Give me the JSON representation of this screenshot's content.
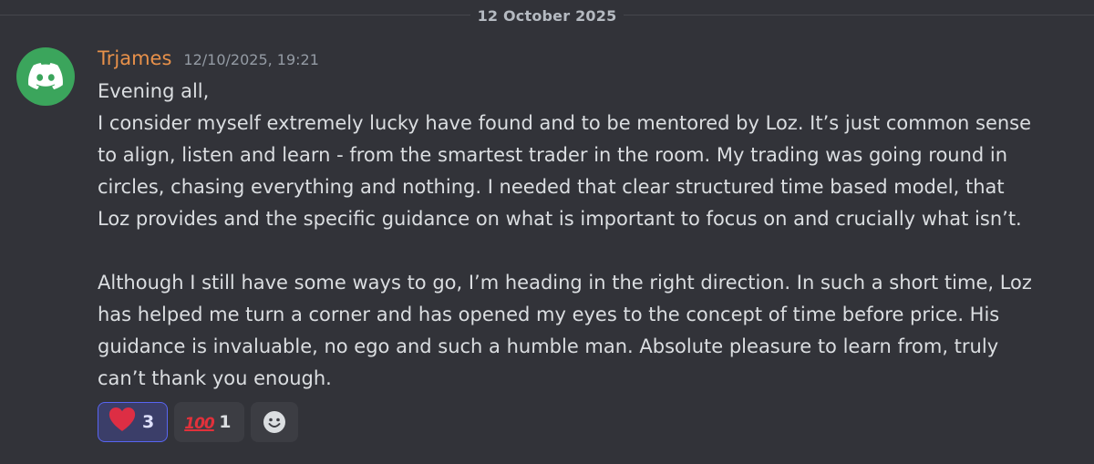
{
  "date_divider": "12 October 2025",
  "message": {
    "author": "Trjames",
    "timestamp": "12/10/2025, 19:21",
    "avatar_icon": "discord-logo-icon",
    "avatar_color": "#3ba55c",
    "username_color": "#e8914a",
    "lines": [
      "Evening all,",
      "I consider myself extremely lucky have found and to be mentored by Loz. It’s just common sense",
      "to align, listen and learn - from the smartest trader in the room.  My trading was going round in",
      "circles, chasing everything and nothing.  I needed that clear structured time based model, that",
      "Loz provides and the specific guidance on what is important to focus on and crucially what isn’t.",
      "",
      "Although I still have some ways to go, I’m heading in the right direction. In such a short time, Loz",
      "has helped me turn a corner and has opened my eyes to the concept of time before price.  His",
      "guidance is invaluable, no ego and such a humble man. Absolute pleasure to learn from, truly",
      "can’t thank you enough."
    ]
  },
  "reactions": [
    {
      "emoji": "❤",
      "emoji_name": "heart",
      "count": "3",
      "active": true
    },
    {
      "emoji": "100",
      "emoji_name": "hundred-points",
      "count": "1",
      "active": false
    }
  ],
  "add_reaction_icon": "smiley-face-icon"
}
